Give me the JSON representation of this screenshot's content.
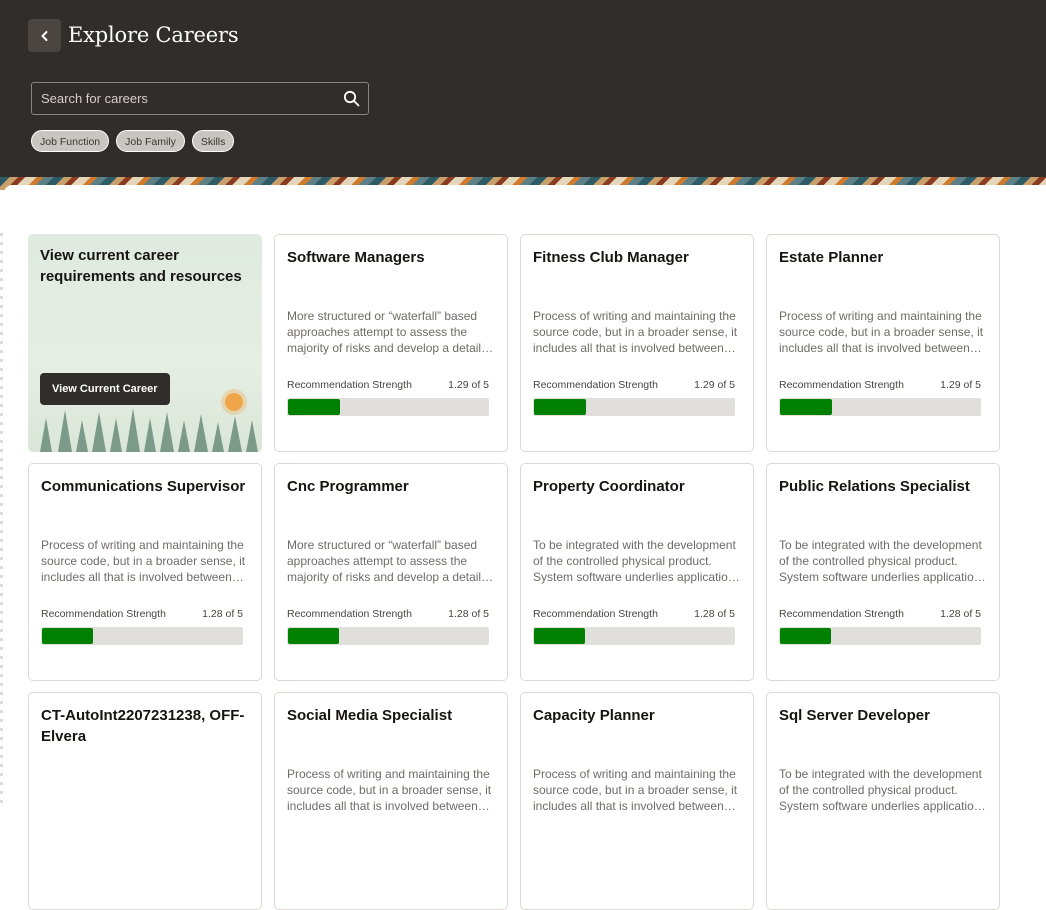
{
  "header": {
    "title": "Explore Careers",
    "search_placeholder": "Search for careers",
    "chips": [
      "Job Function",
      "Job Family",
      "Skills"
    ]
  },
  "feature": {
    "title": "View current career requirements and resources",
    "button": "View Current Career"
  },
  "cards": [
    {
      "title": "Software Managers",
      "desc": "More structured or “waterfall” based approaches attempt to assess the majority of risks and develop a detailed plan for the software",
      "rec_label": "Recommendation Strength",
      "rec_value": "1.29 of 5",
      "score": 1.29
    },
    {
      "title": "Fitness Club Manager",
      "desc": "Process of writing and maintaining the source code, but in a broader sense, it includes all that is involved between the conception",
      "rec_label": "Recommendation Strength",
      "rec_value": "1.29 of 5",
      "score": 1.29
    },
    {
      "title": "Estate Planner",
      "desc": "Process of writing and maintaining the source code, but in a broader sense, it includes all that is involved between the conception",
      "rec_label": "Recommendation Strength",
      "rec_value": "1.29 of 5",
      "score": 1.29
    },
    {
      "title": "Communications Supervisor",
      "desc": "Process of writing and maintaining the source code, but in a broader sense, it includes all that is involved between the conception",
      "rec_label": "Recommendation Strength",
      "rec_value": "1.28 of 5",
      "score": 1.28
    },
    {
      "title": "Cnc Programmer",
      "desc": "More structured or “waterfall” based approaches attempt to assess the majority of risks and develop a detailed plan for the software",
      "rec_label": "Recommendation Strength",
      "rec_value": "1.28 of 5",
      "score": 1.28
    },
    {
      "title": "Property Coordinator",
      "desc": "To be integrated with the development of the controlled physical product. System software underlies applications and the programming",
      "rec_label": "Recommendation Strength",
      "rec_value": "1.28 of 5",
      "score": 1.28
    },
    {
      "title": "Public Relations Specialist",
      "desc": "To be integrated with the development of the controlled physical product. System software underlies applications and the programming",
      "rec_label": "Recommendation Strength",
      "rec_value": "1.28 of 5",
      "score": 1.28
    },
    {
      "title": "CT-AutoInt2207231238, OFF-Elvera",
      "desc": "",
      "rec_label": "",
      "rec_value": "",
      "score": null
    },
    {
      "title": "Social Media Specialist",
      "desc": "Process of writing and maintaining the source code, but in a broader sense, it includes all that is involved between the conception",
      "rec_label": "",
      "rec_value": "",
      "score": null
    },
    {
      "title": "Capacity Planner",
      "desc": "Process of writing and maintaining the source code, but in a broader sense, it includes all that is involved between the conception",
      "rec_label": "",
      "rec_value": "",
      "score": null
    },
    {
      "title": "Sql Server Developer",
      "desc": "To be integrated with the development of the controlled physical product. System software underlies applications and the programming",
      "rec_label": "",
      "rec_value": "",
      "score": null
    }
  ],
  "colors": {
    "header_bg": "#312d2a",
    "bar_fill": "#008000",
    "bar_track": "#e1dfdc"
  },
  "icons": {
    "back": "chevron-left-icon",
    "search": "search-icon"
  }
}
